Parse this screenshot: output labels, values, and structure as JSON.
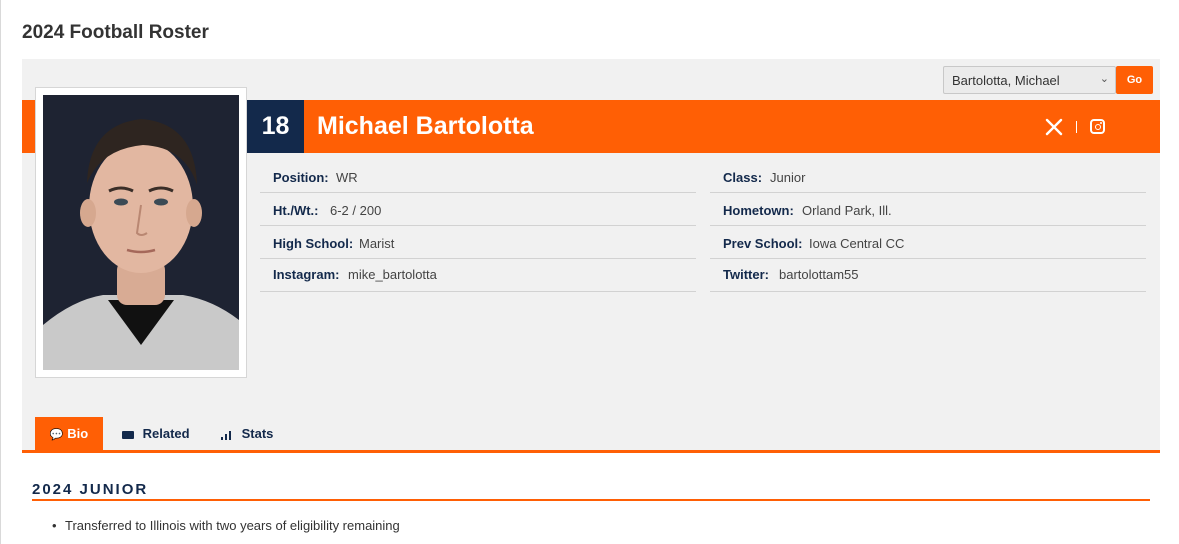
{
  "page": {
    "title": "2024 Football Roster"
  },
  "selector": {
    "selected": "Bartolotta, Michael",
    "go_label": "Go"
  },
  "player": {
    "number": "18",
    "name": "Michael Bartolotta"
  },
  "social": {
    "twitter_icon": "x-icon",
    "instagram_icon": "instagram-icon"
  },
  "details": {
    "left": [
      {
        "label": "Position:",
        "value": "WR"
      },
      {
        "label": "Ht./Wt.:",
        "value": "6-2 / 200"
      },
      {
        "label": "High School:",
        "value": "Marist"
      },
      {
        "label": "Instagram:",
        "value": "mike_bartolotta"
      }
    ],
    "right": [
      {
        "label": "Class:",
        "value": "Junior"
      },
      {
        "label": "Hometown:",
        "value": "Orland Park, Ill."
      },
      {
        "label": "Prev School:",
        "value": "Iowa Central CC"
      },
      {
        "label": "Twitter:",
        "value": "bartolottam55"
      }
    ]
  },
  "tabs": [
    {
      "label": "Bio",
      "icon": "speech-bubble-icon",
      "active": true
    },
    {
      "label": "Related",
      "icon": "cards-icon",
      "active": false
    },
    {
      "label": "Stats",
      "icon": "bar-chart-icon",
      "active": false
    }
  ],
  "bio": {
    "section_title": "2024 JUNIOR",
    "bullets": [
      "Transferred to Illinois with two years of eligibility remaining"
    ]
  },
  "colors": {
    "orange": "#ff5f05",
    "navy": "#13294b",
    "panel": "#f1f1f1"
  }
}
